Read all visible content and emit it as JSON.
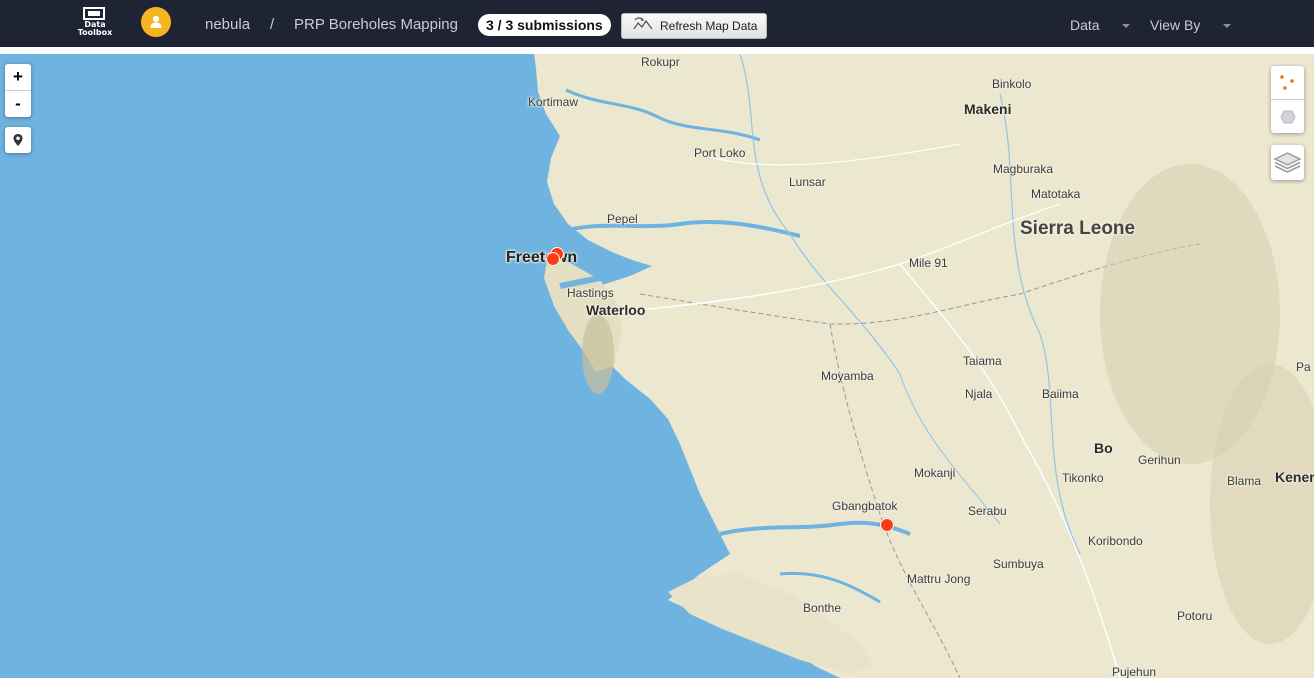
{
  "navbar": {
    "logo_text_line1": "Data",
    "logo_text_line2": "Toolbox",
    "project": "nebula",
    "separator": "/",
    "form_name": "PRP Boreholes Mapping",
    "submissions": "3 / 3 submissions",
    "refresh_label": "Refresh Map Data",
    "data_menu": "Data",
    "view_by_menu": "View By",
    "colors": {
      "background": "#1e2433",
      "avatar": "#f5b521"
    }
  },
  "map_controls": {
    "zoom_in": "+",
    "zoom_out": "-"
  },
  "map": {
    "colors": {
      "water": "#6fb3e0",
      "land": "#ece7cf",
      "marker": "#ff3b14"
    },
    "places": {
      "rokupr": "Rokupr",
      "kortimaw": "Kortimaw",
      "binkolo": "Binkolo",
      "makeni": "Makeni",
      "port_loko": "Port Loko",
      "magburaka": "Magburaka",
      "lunsar": "Lunsar",
      "matotaka": "Matotaka",
      "pepel": "Pepel",
      "sierra_leone": "Sierra Leone",
      "freetown": "Freetown",
      "mile_91": "Mile 91",
      "hastings": "Hastings",
      "waterloo": "Waterloo",
      "taiama": "Taiama",
      "moyamba": "Moyamba",
      "njala": "Njala",
      "baiima": "Baiima",
      "pa": "Pa",
      "bo": "Bo",
      "gerihun": "Gerihun",
      "mokanji": "Mokanji",
      "tikonko": "Tikonko",
      "blama": "Blama",
      "kenema": "Kener",
      "gbangbatok": "Gbangbatok",
      "serabu": "Serabu",
      "koribondo": "Koribondo",
      "mattru_jong": "Mattru Jong",
      "sumbuya": "Sumbuya",
      "bonthe": "Bonthe",
      "potoru": "Potoru",
      "pujehun": "Pujehun"
    },
    "submission_markers": [
      "Freetown borehole 1",
      "Freetown borehole 2",
      "Gbangbatok borehole"
    ]
  }
}
